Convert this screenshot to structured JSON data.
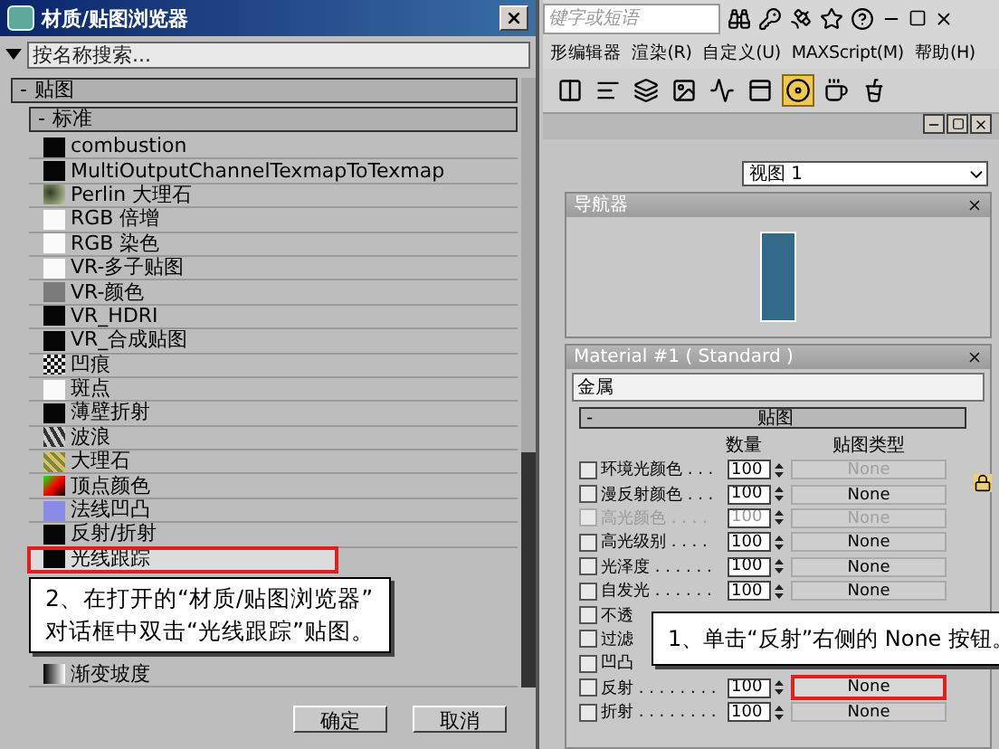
{
  "dialog": {
    "title": "材质/贴图浏览器",
    "search": {
      "placeholder": "按名称搜索..."
    },
    "group": {
      "toggle": "-",
      "label": "贴图"
    },
    "subgroup": {
      "toggle": "-",
      "label": "标准"
    },
    "items": [
      {
        "label": "combustion",
        "kind": "black",
        "selected": false
      },
      {
        "label": "MultiOutputChannelTexmapToTexmap",
        "kind": "black",
        "selected": false
      },
      {
        "label": "Perlin 大理石",
        "kind": "perlin",
        "selected": false
      },
      {
        "label": "RGB 倍增",
        "kind": "white",
        "selected": false
      },
      {
        "label": "RGB 染色",
        "kind": "white",
        "selected": false
      },
      {
        "label": "VR-多子贴图",
        "kind": "white",
        "selected": false
      },
      {
        "label": "VR-颜色",
        "kind": "grey",
        "selected": false
      },
      {
        "label": "VR_HDRI",
        "kind": "black",
        "selected": false
      },
      {
        "label": "VR_合成贴图",
        "kind": "black",
        "selected": false
      },
      {
        "label": "凹痕",
        "kind": "checker",
        "selected": false
      },
      {
        "label": "斑点",
        "kind": "white",
        "selected": false
      },
      {
        "label": "薄壁折射",
        "kind": "black",
        "selected": false
      },
      {
        "label": "波浪",
        "kind": "wave",
        "selected": false
      },
      {
        "label": "大理石",
        "kind": "marble",
        "selected": false
      },
      {
        "label": "顶点颜色",
        "kind": "vertex",
        "selected": false
      },
      {
        "label": "法线凹凸",
        "kind": "normal",
        "selected": false
      },
      {
        "label": "反射/折射",
        "kind": "black",
        "selected": false
      },
      {
        "label": "光线跟踪",
        "kind": "black",
        "selected": true
      }
    ],
    "last_item": {
      "label": "渐变坡度",
      "kind": "gradient",
      "selected": false
    },
    "callout": [
      "2、在打开的“材质/贴图浏览器”",
      "对话框中双击“光线跟踪”贴图。"
    ],
    "buttons": [
      "确定",
      "取消"
    ]
  },
  "app": {
    "search": {
      "placeholder": "键字或短语"
    },
    "menu": [
      "形编辑器",
      "渲染(R)",
      "自定义(U)",
      "MAXScript(M)",
      "帮助(H)"
    ],
    "view_select": {
      "value": "视图 1"
    },
    "navigator": {
      "title": "导航器"
    },
    "material": {
      "title": "Material #1 ( Standard )",
      "name": "金属",
      "rollout": {
        "toggle": "-",
        "title": "贴图"
      },
      "columns": [
        "数量",
        "贴图类型"
      ],
      "rows": [
        {
          "kind": "full",
          "label": "环境光颜色 . . .",
          "amount": "100",
          "map": "None",
          "disabled": false,
          "map_disabled": true,
          "selected": false
        },
        {
          "kind": "full",
          "label": "漫反射颜色 . . .",
          "amount": "100",
          "map": "None",
          "disabled": false,
          "map_disabled": false,
          "selected": false
        },
        {
          "kind": "full",
          "label": "高光颜色 . . . .",
          "amount": "100",
          "map": "None",
          "disabled": true,
          "map_disabled": true,
          "selected": false
        },
        {
          "kind": "full",
          "label": "高光级别 . . . .",
          "amount": "100",
          "map": "None",
          "disabled": false,
          "map_disabled": false,
          "selected": false
        },
        {
          "kind": "full",
          "label": "光泽度 . . . . . .",
          "amount": "100",
          "map": "None",
          "disabled": false,
          "map_disabled": false,
          "selected": false
        },
        {
          "kind": "full",
          "label": "自发光 . . . . . .",
          "amount": "100",
          "map": "None",
          "disabled": false,
          "map_disabled": false,
          "selected": false
        },
        {
          "kind": "covered",
          "label": "不透",
          "disabled": false,
          "selected": false
        },
        {
          "kind": "covered",
          "label": "过滤",
          "disabled": false,
          "selected": false
        },
        {
          "kind": "covered",
          "label": "凹凸",
          "disabled": false,
          "selected": false
        },
        {
          "kind": "full",
          "label": "反射 . . . . . . . .",
          "amount": "100",
          "map": "None",
          "disabled": false,
          "map_disabled": false,
          "selected": true
        },
        {
          "kind": "full",
          "label": "折射 . . . . . . . .",
          "amount": "100",
          "map": "None",
          "disabled": false,
          "map_disabled": false,
          "selected": false
        }
      ]
    },
    "callout": "1、单击“反射”右侧的 None 按钮。"
  }
}
